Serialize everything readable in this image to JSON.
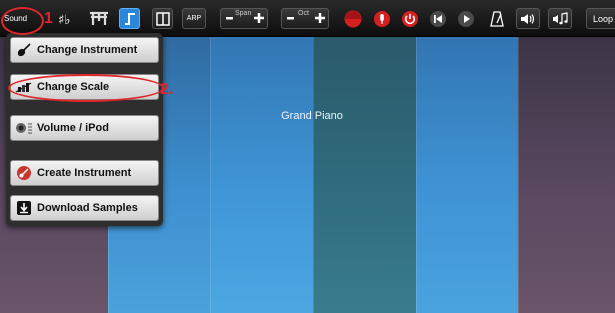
{
  "toolbar": {
    "sound_label": "Sound",
    "arp_label": "ARP",
    "span_label": "Span",
    "oct_label": "Oct",
    "loop_label": "Loop",
    "icons": [
      "sharp-flat-icon",
      "keyboard-layout-icon",
      "glide-icon",
      "split-view-icon",
      "minus-icon",
      "plus-icon",
      "record-icon",
      "microphone-icon",
      "power-icon",
      "skip-back-icon",
      "play-icon",
      "metronome-icon",
      "volume-speaker-icon",
      "music-note-icon"
    ]
  },
  "keyboard": {
    "instrument_name": "Grand Piano"
  },
  "menu": {
    "items": [
      {
        "label": "Change Instrument",
        "icon": "guitar-icon"
      },
      {
        "label": "Change Scale",
        "icon": "scale-icon"
      },
      {
        "label": "Volume / iPod",
        "icon": "volume-knob-icon"
      },
      {
        "label": "Create Instrument",
        "icon": "create-instrument-icon"
      },
      {
        "label": "Download Samples",
        "icon": "download-icon"
      }
    ]
  },
  "annotations": {
    "step1": "1",
    "step2": "2."
  },
  "colors": {
    "annotation_red": "#e0262a",
    "toolbar_accent_blue": "#2a86d8",
    "record_red": "#d61f1f"
  }
}
